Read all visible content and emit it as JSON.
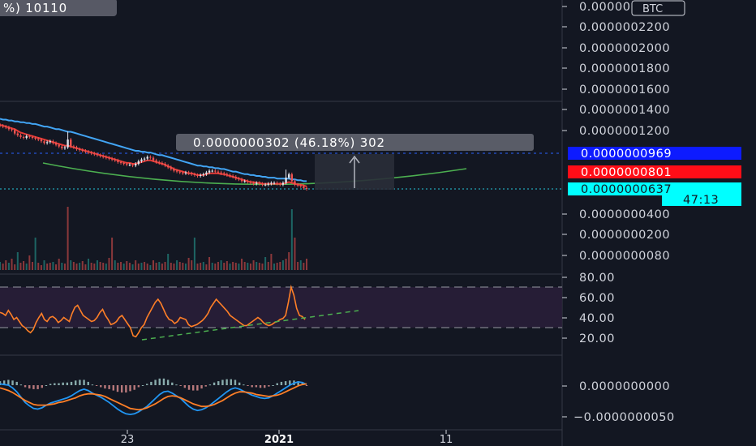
{
  "chart_data": {
    "type": "candlestick",
    "x_ticks": [
      "23",
      "2021",
      "11"
    ],
    "top_box": {
      "text": "%) 10110"
    },
    "price_axis": {
      "currency": "BTC",
      "ticks": [
        "0.0000002400",
        "0.0000002200",
        "0.0000002000",
        "0.0000001800",
        "0.0000001600",
        "0.0000001400",
        "0.0000001200",
        "0.0000000400",
        "0.0000000200",
        "0.0000000080"
      ],
      "tags": [
        {
          "value": "0.0000000969",
          "color": "#0d1bff"
        },
        {
          "value": "0.0000000801",
          "color": "#ff0d17"
        },
        {
          "value": "0.0000000637",
          "color": "#00ffff"
        }
      ],
      "countdown": "47:13"
    },
    "measure": {
      "text": "0.0000000302 (46.18%) 302"
    },
    "rsi": {
      "ticks": [
        "80.00",
        "60.00",
        "40.00",
        "20.00"
      ],
      "upper": 70,
      "lower": 30,
      "values": [
        45,
        44,
        42,
        47,
        43,
        38,
        40,
        36,
        32,
        30,
        27,
        25,
        28,
        35,
        40,
        44,
        38,
        36,
        40,
        41,
        39,
        35,
        37,
        40,
        38,
        36,
        44,
        50,
        52,
        47,
        42,
        40,
        38,
        36,
        37,
        40,
        45,
        48,
        42,
        38,
        33,
        34,
        36,
        40,
        42,
        38,
        34,
        30,
        22,
        21,
        25,
        30,
        33,
        40,
        45,
        50,
        55,
        58,
        54,
        48,
        42,
        38,
        37,
        34,
        36,
        40,
        39,
        38,
        33,
        31,
        32,
        33,
        35,
        37,
        40,
        44,
        50,
        54,
        58,
        55,
        52,
        49,
        46,
        42,
        40,
        38,
        36,
        34,
        32,
        32,
        34,
        36,
        38,
        40,
        38,
        35,
        33,
        32,
        33,
        35,
        36,
        38,
        39,
        42,
        55,
        70,
        62,
        49,
        42,
        41,
        38
      ],
      "trend": [
        [
          19,
          177
        ],
        [
          44,
          386
        ]
      ]
    },
    "macd": {
      "ticks": [
        "0.0000000000",
        "-0.0000000050"
      ],
      "macd_line": [
        0.2,
        0.1,
        0.0,
        -0.4,
        -1.0,
        -1.8,
        -2.6,
        -3.1,
        -3.5,
        -3.6,
        -3.4,
        -3.0,
        -2.7,
        -2.5,
        -2.3,
        -2.1,
        -1.9,
        -1.6,
        -1.2,
        -0.8,
        -0.6,
        -0.8,
        -1.2,
        -1.5,
        -1.8,
        -2.2,
        -2.6,
        -3.1,
        -3.6,
        -4.0,
        -4.3,
        -4.4,
        -4.3,
        -4.0,
        -3.6,
        -3.2,
        -2.6,
        -2.0,
        -1.4,
        -1.0,
        -0.9,
        -1.2,
        -1.6,
        -2.0,
        -2.6,
        -3.2,
        -3.6,
        -3.8,
        -3.7,
        -3.4,
        -3.0,
        -2.5,
        -2.0,
        -1.5,
        -1.0,
        -0.6,
        -0.4,
        -0.6,
        -0.9,
        -1.2,
        -1.5,
        -1.7,
        -1.9,
        -2.0,
        -1.9,
        -1.6,
        -1.2,
        -0.8,
        -0.4,
        0.0,
        0.3,
        0.5,
        0.4,
        0.1
      ],
      "signal_line": [
        -0.4,
        -0.6,
        -0.8,
        -1.1,
        -1.5,
        -1.9,
        -2.3,
        -2.6,
        -2.9,
        -3.0,
        -3.0,
        -3.0,
        -2.9,
        -2.8,
        -2.6,
        -2.5,
        -2.3,
        -2.1,
        -1.9,
        -1.6,
        -1.4,
        -1.3,
        -1.3,
        -1.4,
        -1.5,
        -1.7,
        -2.0,
        -2.3,
        -2.6,
        -2.9,
        -3.2,
        -3.5,
        -3.6,
        -3.7,
        -3.6,
        -3.4,
        -3.1,
        -2.8,
        -2.4,
        -2.0,
        -1.7,
        -1.6,
        -1.7,
        -1.9,
        -2.2,
        -2.5,
        -2.8,
        -3.0,
        -3.2,
        -3.2,
        -3.1,
        -2.9,
        -2.6,
        -2.3,
        -1.9,
        -1.5,
        -1.2,
        -1.0,
        -1.0,
        -1.1,
        -1.2,
        -1.4,
        -1.5,
        -1.6,
        -1.7,
        -1.6,
        -1.5,
        -1.3,
        -1.0,
        -0.7,
        -0.4,
        -0.1,
        0.1,
        0.2
      ]
    },
    "price_series": {
      "closes": [
        140,
        139,
        138,
        136,
        135,
        131,
        129,
        127,
        126,
        128,
        127,
        126,
        125,
        124,
        122,
        120,
        121,
        122,
        120,
        118,
        116,
        114,
        115,
        124,
        116,
        115,
        113,
        112,
        111,
        110,
        109,
        108,
        107,
        106,
        105,
        104,
        103,
        102,
        101,
        100,
        98,
        97,
        96,
        95,
        95,
        94,
        96,
        99,
        101,
        102,
        104,
        103,
        100,
        98,
        97,
        96,
        94,
        92,
        90,
        88,
        87,
        86,
        85,
        86,
        85,
        84,
        83,
        82,
        83,
        84,
        86,
        88,
        88,
        87,
        86,
        85,
        84,
        83,
        82,
        81,
        79,
        78,
        76,
        76,
        75,
        74,
        73,
        74,
        73,
        72,
        72,
        73,
        74,
        74,
        73,
        72,
        74,
        80,
        84,
        76,
        72,
        71,
        70,
        68,
        67
      ],
      "ema_fast": [
        141,
        140,
        139,
        138,
        137,
        136,
        134,
        132,
        131,
        130,
        129,
        128,
        127,
        126,
        125,
        124,
        123,
        122,
        121,
        120,
        119,
        118,
        117,
        117,
        116,
        115,
        114,
        113,
        112,
        111,
        110,
        109,
        108,
        107,
        106,
        105,
        104,
        103,
        102,
        101,
        100,
        99,
        98,
        97,
        97,
        96,
        96,
        97,
        98,
        99,
        100,
        100,
        99,
        98,
        97,
        96,
        95,
        93,
        92,
        90,
        89,
        88,
        87,
        86,
        85,
        85,
        84,
        83,
        83,
        83,
        84,
        85,
        85,
        85,
        85,
        84,
        84,
        83,
        82,
        81,
        80,
        79,
        78,
        77,
        76,
        75,
        75,
        74,
        74,
        73,
        73,
        73,
        73,
        73,
        73,
        73,
        73,
        74,
        75,
        74,
        73,
        72,
        72,
        71,
        70
      ],
      "ema_slow": [
        148,
        147,
        147,
        146,
        146,
        145,
        145,
        144,
        144,
        143,
        143,
        142,
        142,
        141,
        140,
        139,
        139,
        138,
        137,
        136,
        136,
        135,
        134,
        133,
        133,
        132,
        131,
        130,
        129,
        128,
        127,
        126,
        125,
        124,
        123,
        122,
        121,
        120,
        119,
        118,
        117,
        116,
        115,
        114,
        113,
        112,
        111,
        111,
        110,
        110,
        109,
        109,
        108,
        107,
        106,
        106,
        105,
        104,
        103,
        102,
        101,
        100,
        99,
        98,
        97,
        96,
        95,
        94,
        94,
        93,
        93,
        92,
        92,
        91,
        91,
        90,
        90,
        89,
        88,
        87,
        87,
        86,
        85,
        84,
        84,
        83,
        83,
        82,
        82,
        81,
        81,
        80,
        80,
        80,
        79,
        79,
        79,
        79,
        79,
        78,
        78,
        77,
        77,
        76,
        76
      ],
      "volumes": [
        10,
        8,
        12,
        9,
        14,
        7,
        22,
        9,
        11,
        8,
        18,
        10,
        40,
        9,
        6,
        12,
        8,
        9,
        10,
        7,
        14,
        9,
        8,
        78,
        12,
        10,
        8,
        9,
        11,
        7,
        14,
        9,
        8,
        12,
        10,
        9,
        8,
        15,
        40,
        12,
        9,
        10,
        8,
        11,
        9,
        7,
        12,
        8,
        9,
        10,
        8,
        6,
        12,
        9,
        10,
        8,
        10,
        20,
        9,
        8,
        12,
        10,
        9,
        8,
        15,
        12,
        40,
        8,
        9,
        10,
        7,
        16,
        9,
        8,
        10,
        12,
        9,
        11,
        8,
        10,
        9,
        8,
        14,
        10,
        9,
        8,
        12,
        10,
        9,
        8,
        16,
        10,
        20,
        8,
        9,
        10,
        12,
        14,
        22,
        75,
        40,
        10,
        12,
        9,
        14
      ]
    }
  }
}
